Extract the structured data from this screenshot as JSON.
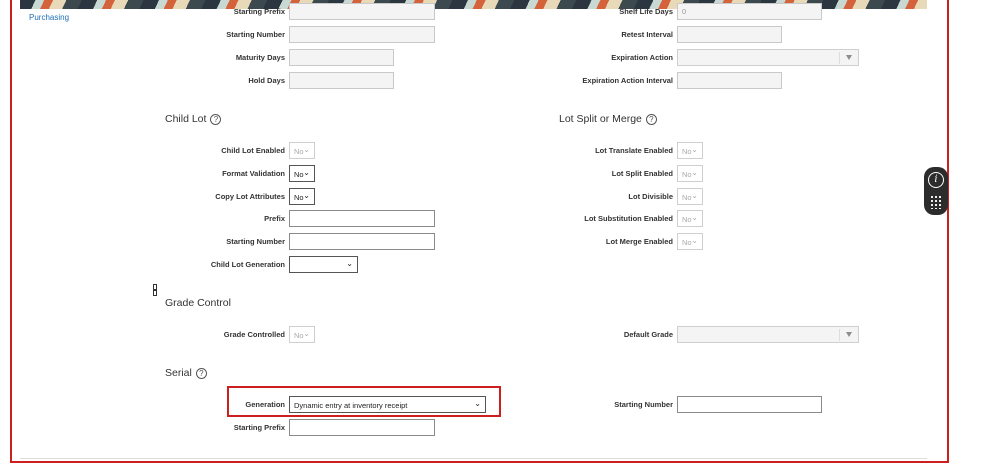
{
  "sidebar": {
    "link": "Purchasing"
  },
  "lot_top": {
    "starting_prefix": "Starting Prefix",
    "starting_number": "Starting Number",
    "maturity_days": "Maturity Days",
    "hold_days": "Hold Days",
    "shelf_life_days": "Shelf Life Days",
    "shelf_life_value": "0",
    "retest_interval": "Retest Interval",
    "expiration_action": "Expiration Action",
    "expiration_action_interval": "Expiration Action Interval"
  },
  "child_lot": {
    "title": "Child Lot",
    "child_lot_enabled": "Child Lot Enabled",
    "child_lot_enabled_value": "No",
    "format_validation": "Format Validation",
    "format_validation_value": "No",
    "copy_lot_attributes": "Copy Lot Attributes",
    "copy_lot_attributes_value": "No",
    "prefix": "Prefix",
    "starting_number": "Starting Number",
    "child_lot_generation": "Child Lot Generation"
  },
  "lot_split": {
    "title": "Lot Split or Merge",
    "lot_translate_enabled": "Lot Translate Enabled",
    "lot_translate_value": "No",
    "lot_split_enabled": "Lot Split Enabled",
    "lot_split_value": "No",
    "lot_divisible": "Lot Divisible",
    "lot_divisible_value": "No",
    "lot_substitution_enabled": "Lot Substitution Enabled",
    "lot_substitution_value": "No",
    "lot_merge_enabled": "Lot Merge Enabled",
    "lot_merge_value": "No"
  },
  "grade": {
    "title": "Grade Control",
    "grade_controlled": "Grade Controlled",
    "grade_controlled_value": "No",
    "default_grade": "Default Grade"
  },
  "serial": {
    "title": "Serial",
    "generation": "Generation",
    "generation_value": "Dynamic entry at inventory receipt",
    "starting_prefix": "Starting Prefix",
    "starting_number": "Starting Number"
  },
  "icons": {
    "help": "?",
    "info": "i",
    "chevron": "⌄"
  }
}
